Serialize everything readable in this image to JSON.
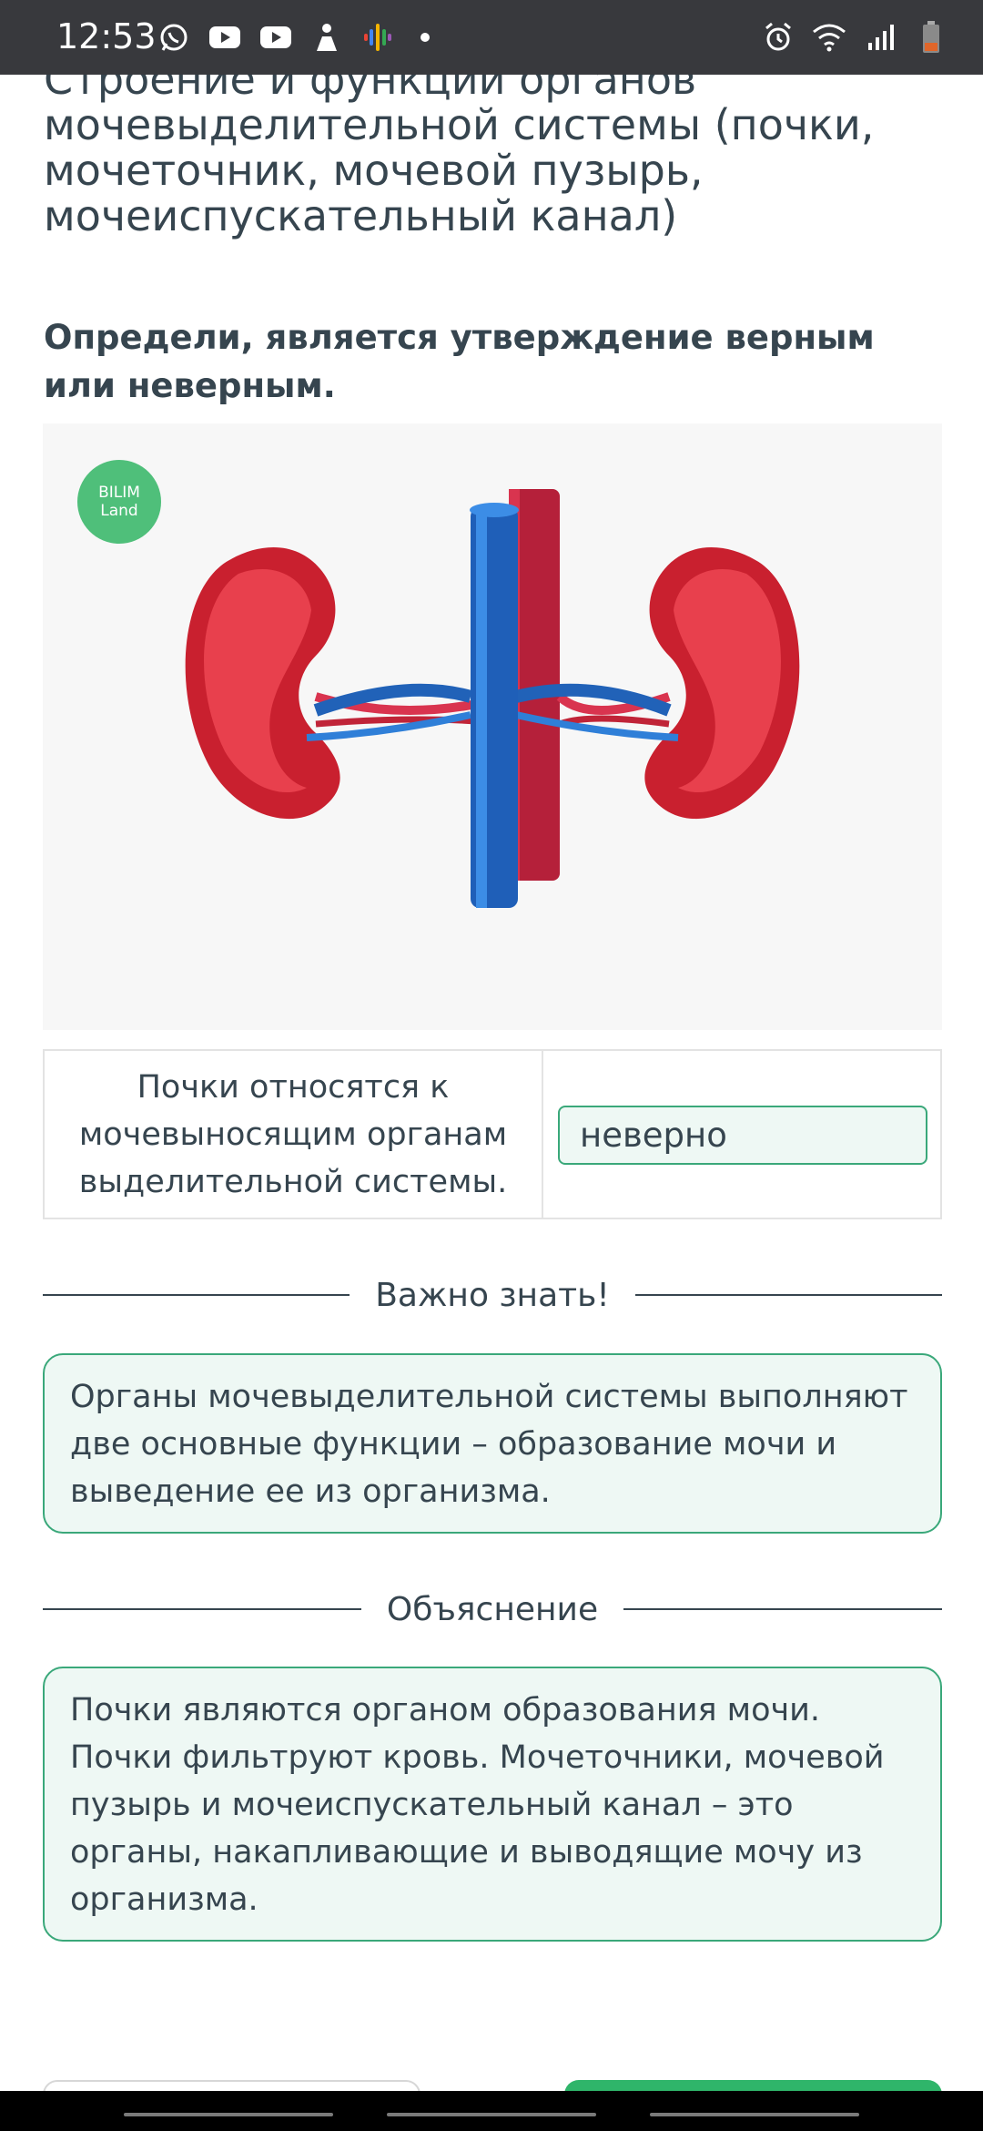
{
  "status_bar": {
    "time": "12:53",
    "left_icons": [
      "whatsapp-icon",
      "youtube-icon",
      "youtube-icon",
      "app-icon",
      "podcasts-icon",
      "dot"
    ],
    "right_icons": [
      "alarm-icon",
      "wifi-icon",
      "signal-icon",
      "battery-icon"
    ]
  },
  "page": {
    "title": "Строение и функции органов мочевыделительной системы (почки, мочеточник, мочевой пузырь, мочеиспускательный канал)",
    "question": "Определи, является утверждение верным или неверным."
  },
  "image": {
    "logo_text": "BILIM Land",
    "subject": "kidneys-illustration"
  },
  "statement": {
    "text": "Почки относятся к мочевыносящим органам выделительной системы.",
    "answer": "неверно"
  },
  "important": {
    "heading": "Важно знать!",
    "text": "Органы мочевыделительной системы выполняют две основные функции – образование мочи и выведение ее из организма."
  },
  "explanation": {
    "heading": "Объяснение",
    "text": "Почки являются органом образования мочи. Почки фильтруют кровь. Мочеточники, мочевой пузырь и мочеиспускательный канал – это органы, накапливающие и выводящие мочу из организма."
  },
  "colors": {
    "accent": "#3aa87a",
    "accent_bg": "#eef8f4",
    "button_green": "#2fb56a",
    "text": "#36454f"
  }
}
